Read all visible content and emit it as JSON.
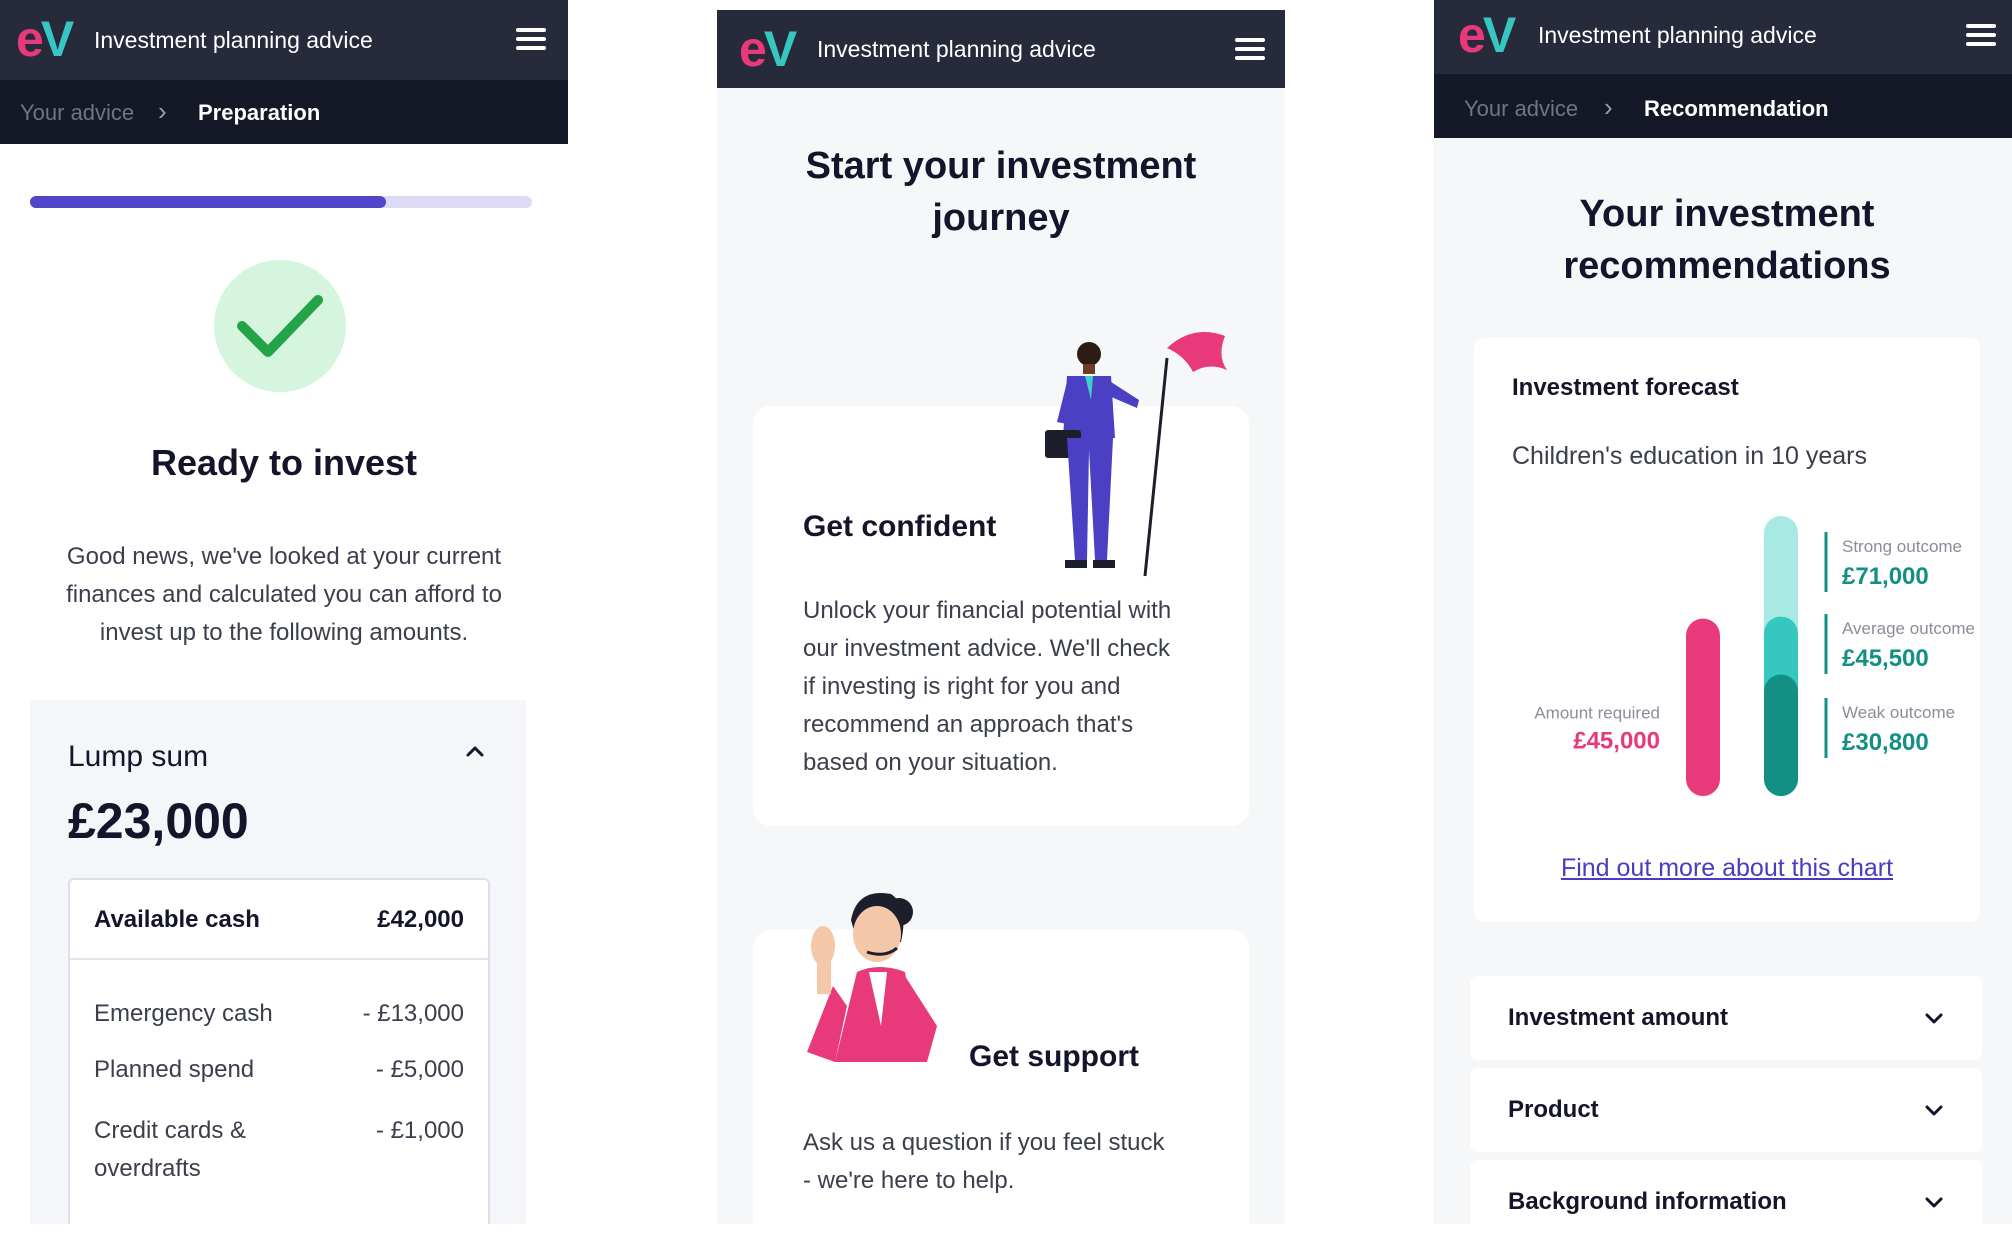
{
  "brand": {
    "logo_e": "e",
    "logo_v": "V",
    "title": "Investment planning advice"
  },
  "colors": {
    "navbar": "#262a3b",
    "breadcrumb_bar": "#151826",
    "pink": "#e8397a",
    "teal": "#35c7c0",
    "dark_teal": "#148f84",
    "progress": "#5146c9",
    "link": "#4a3cc0"
  },
  "screen1": {
    "breadcrumb": {
      "prev": "Your advice",
      "current": "Preparation"
    },
    "progress": 0.71,
    "status_icon": "check-icon",
    "heading": "Ready to invest",
    "intro_lines": [
      "Good news, we've looked at your current",
      "finances and calculated you can afford to",
      "invest up to the following amounts."
    ],
    "lump_sum": {
      "label": "Lump sum",
      "amount": "£23,000",
      "available": {
        "label": "Available cash",
        "value": "£42,000"
      },
      "deductions": [
        {
          "label": "Emergency cash",
          "value": "- £13,000"
        },
        {
          "label": "Planned spend",
          "value": "- £5,000"
        },
        {
          "label_lines": [
            "Credit cards &",
            "overdrafts"
          ],
          "value": "- £1,000"
        }
      ]
    }
  },
  "screen2": {
    "heading_lines": [
      "Start your investment",
      "journey"
    ],
    "confident": {
      "title": "Get confident",
      "lines": [
        "Unlock your financial potential with",
        "our investment advice. We'll check",
        "if investing is right for you and",
        "recommend an approach that's",
        "based on your situation."
      ]
    },
    "support": {
      "title": "Get support",
      "lines": [
        "Ask us a question if you feel stuck",
        "- we're here to help."
      ]
    }
  },
  "screen3": {
    "breadcrumb": {
      "prev": "Your advice",
      "current": "Recommendation"
    },
    "heading_lines": [
      "Your investment",
      "recommendations"
    ],
    "forecast": {
      "title": "Investment forecast",
      "subtitle": "Children's education in 10 years",
      "link": "Find out more about this chart"
    },
    "chart_data": {
      "type": "bar",
      "categories": [
        "Amount required",
        "Weak outcome",
        "Average outcome",
        "Strong outcome"
      ],
      "values": [
        45000,
        30800,
        45500,
        71000
      ],
      "value_labels": [
        "£45,000",
        "£30,800",
        "£45,500",
        "£71,000"
      ],
      "title": "Investment forecast",
      "subtitle": "Children's education in 10 years"
    },
    "accordions": [
      "Investment amount",
      "Product",
      "Background information"
    ]
  }
}
